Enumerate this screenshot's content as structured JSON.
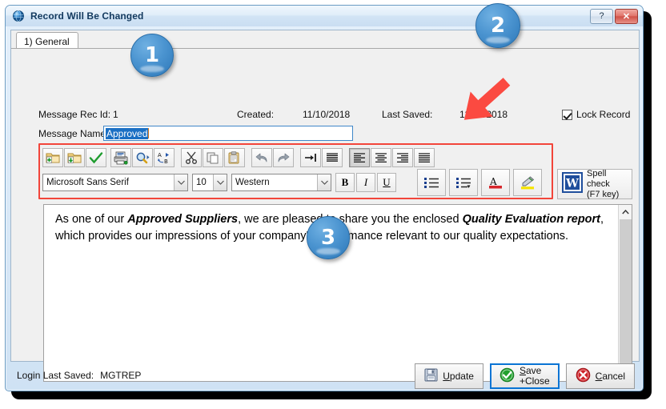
{
  "window": {
    "title": "Record Will Be Changed",
    "icon": "globe-icon",
    "help_label": "?",
    "close_label": "✕"
  },
  "tabs": [
    {
      "label": "1) General",
      "active": true
    }
  ],
  "fields": {
    "rec_id_label": "Message Rec Id:",
    "rec_id_value": "1",
    "created_label": "Created:",
    "created_value": "11/10/2018",
    "last_saved_label": "Last Saved:",
    "last_saved_value": "12/08/2018",
    "lock_record_label": "Lock Record",
    "lock_record_checked": true,
    "message_name_label": "Message Name:",
    "message_name_value": "Approved",
    "message_name_placeholder": "Message Name"
  },
  "toolbar": {
    "row1": [
      {
        "name": "new-record-icon",
        "title": "New"
      },
      {
        "name": "save-record-icon",
        "title": "Save"
      },
      {
        "name": "check-icon",
        "title": "Accept"
      },
      {
        "name": "print-icon",
        "title": "Print"
      },
      {
        "name": "find-icon",
        "title": "Find"
      },
      {
        "name": "replace-icon",
        "title": "Replace"
      },
      {
        "name": "cut-icon",
        "title": "Cut"
      },
      {
        "name": "copy-icon",
        "title": "Copy"
      },
      {
        "name": "paste-icon",
        "title": "Paste"
      },
      {
        "name": "undo-icon",
        "title": "Undo"
      },
      {
        "name": "redo-icon",
        "title": "Redo"
      },
      {
        "name": "indent-icon",
        "title": "Indent"
      },
      {
        "name": "paragraph-icon",
        "title": "Paragraph"
      },
      {
        "name": "align-left-icon",
        "title": "Align Left",
        "pressed": true
      },
      {
        "name": "align-center-icon",
        "title": "Align Center"
      },
      {
        "name": "align-right-icon",
        "title": "Align Right"
      },
      {
        "name": "align-justify-icon",
        "title": "Justify"
      }
    ],
    "font_family": "Microsoft Sans Serif",
    "font_size": "10",
    "script": "Western",
    "bold_label": "B",
    "italic_label": "I",
    "underline_label": "U",
    "bullets_title": "Bullets",
    "numbering_title": "Multilevel List",
    "font_color_title": "Font Color",
    "highlight_title": "Highlight",
    "spell_check_line1": "Spell check",
    "spell_check_line2": "(F7 key)"
  },
  "editor": {
    "segments": [
      {
        "text": "As one of our ",
        "style": "normal"
      },
      {
        "text": "Approved Suppliers",
        "style": "bold-italic"
      },
      {
        "text": ",  we are pleased to share you the enclosed ",
        "style": "normal"
      },
      {
        "text": "Quality Evaluation report",
        "style": "bold-italic"
      },
      {
        "text": ", which provides our impressions of your company's performance relevant to our quality expectations.",
        "style": "normal"
      }
    ],
    "scroll_up": "▲",
    "scroll_down": "▼"
  },
  "footer": {
    "login_label": "Login Last Saved:",
    "login_value": "MGTREP",
    "update_label": "Update",
    "update_accel": "U",
    "save_label_line1": "Save",
    "save_label_line2": "+Close",
    "save_accel": "S",
    "cancel_label": "Cancel",
    "cancel_accel": "C"
  },
  "callouts": [
    {
      "number": "1"
    },
    {
      "number": "2"
    },
    {
      "number": "3"
    }
  ],
  "colors": {
    "accent": "#3f87c8",
    "badge": "#4b94d0",
    "highlight_outline": "#f2453a",
    "selection": "#1a6fc4",
    "focus_border": "#0a74d4"
  }
}
